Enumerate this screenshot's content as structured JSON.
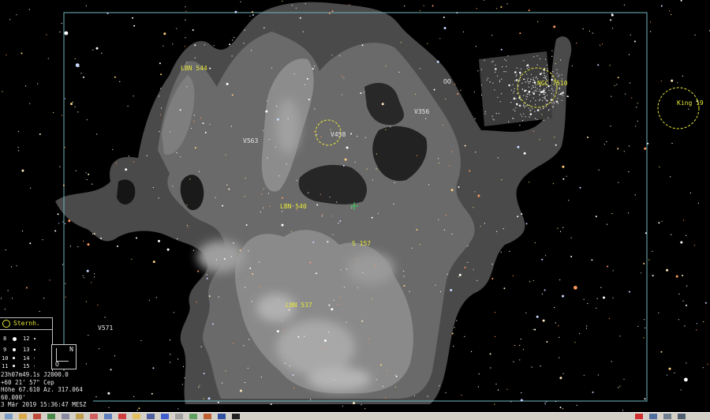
{
  "labels": {
    "lbn544": "LBN 544",
    "v563": "V563",
    "v458": "V458",
    "v356": "V356",
    "oo": "OO",
    "ngc7510": "NGC 7510",
    "king19": "King 19",
    "lbn540": "LBN 540",
    "s157": "S 157",
    "lbn537": "LBN 537",
    "v571": "V571"
  },
  "legend": {
    "title": "Sternh.",
    "mags": [
      "8",
      "9",
      "10",
      "11",
      "12",
      "13",
      "14",
      "15"
    ]
  },
  "compass": {
    "north": "N",
    "east": "O"
  },
  "info": {
    "line1": "23h07m49.1s  J2000.0",
    "line2": "+60 21' 57\"     Cep",
    "line3": "Höhe 67.610  Az. 317.064",
    "line4": "60.000'",
    "line5": "3 Mär 2019 15:36:47 MESZ"
  },
  "colors": {
    "background": "#000000",
    "label_yellow": "#e6e63a",
    "frame_cyan": "#6fb8c0",
    "nebula_light": "#b8b8b8",
    "nebula_dark": "#3a3a3a"
  }
}
